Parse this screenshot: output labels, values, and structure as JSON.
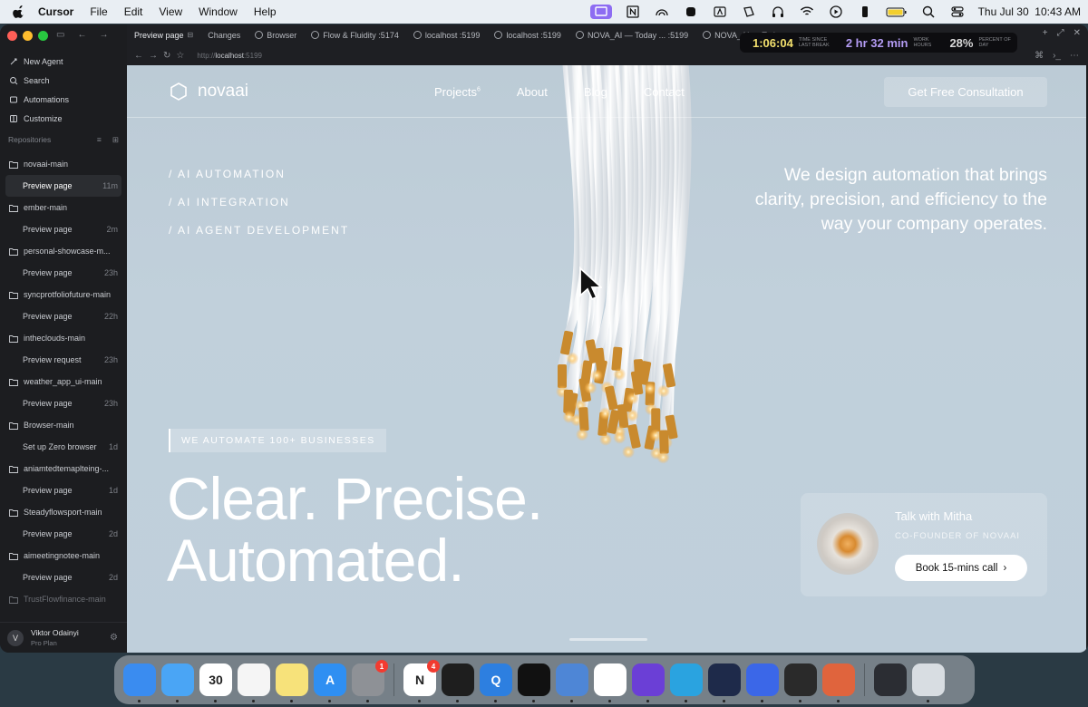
{
  "menubar": {
    "app_name": "Cursor",
    "menus": [
      "File",
      "Edit",
      "View",
      "Window",
      "Help"
    ],
    "clock": "Thu Jul 30  10:43 AM",
    "tray_icons": [
      "display-icon",
      "notion-icon",
      "rainbow-icon",
      "vpn-icon",
      "text-icon",
      "screen-icon",
      "headphones-icon",
      "wifi-icon",
      "play-icon",
      "phone-icon",
      "battery-icon",
      "search-icon",
      "control-center-icon"
    ]
  },
  "sidebar": {
    "nav": [
      {
        "label": "New Agent",
        "icon": "new-agent-icon"
      },
      {
        "label": "Search",
        "icon": "search-icon"
      },
      {
        "label": "Automations",
        "icon": "automations-icon"
      },
      {
        "label": "Customize",
        "icon": "customize-icon"
      }
    ],
    "repos_header": "Repositories",
    "repos": [
      {
        "name": "novaai-main",
        "page": "Preview page",
        "time": "11m",
        "selected": true
      },
      {
        "name": "ember-main",
        "page": "Preview page",
        "time": "2m"
      },
      {
        "name": "personal-showcase-m...",
        "page": "Preview page",
        "time": "23h"
      },
      {
        "name": "syncprotfoliofuture-main",
        "page": "Preview page",
        "time": "22h"
      },
      {
        "name": "intheclouds-main",
        "page": "Preview request",
        "time": "23h"
      },
      {
        "name": "weather_app_ui-main",
        "page": "Preview page",
        "time": "23h"
      },
      {
        "name": "Browser-main",
        "page": "Set up Zero browser",
        "time": "1d"
      },
      {
        "name": "aniamtedtemaplteing-...",
        "page": "Preview page",
        "time": "1d"
      },
      {
        "name": "Steadyflowsport-main",
        "page": "Preview page",
        "time": "2d"
      },
      {
        "name": "aimeetingnotee-main",
        "page": "Preview page",
        "time": "2d"
      },
      {
        "name": "TrustFlowfinance-main",
        "page": "",
        "time": ""
      }
    ],
    "user": {
      "initial": "V",
      "name": "Viktor Odainyi",
      "plan": "Pro Plan"
    }
  },
  "tabs": [
    {
      "label": "Preview page",
      "active": true
    },
    {
      "label": "Changes"
    },
    {
      "label": "Browser",
      "globe": true
    },
    {
      "label": "Flow & Fluidity :5174",
      "globe": true
    },
    {
      "label": "localhost :5199",
      "globe": true
    },
    {
      "label": "localhost :5199",
      "globe": true
    },
    {
      "label": "NOVA_AI — Today ... :5199",
      "globe": true
    },
    {
      "label": "NOVA_AI — Tod",
      "globe": true
    }
  ],
  "timer": {
    "since_break": "1:06:04",
    "since_break_label": "TIME SINCE LAST BREAK",
    "work_hours": "2 hr 32 min",
    "work_hours_label": "WORK HOURS",
    "percent": "28%",
    "percent_label": "PERCENT OF DAY"
  },
  "urlbar": {
    "prefix": "http://",
    "host": "localhost",
    "port": ":5199"
  },
  "site": {
    "logo": "novaai",
    "links": [
      {
        "label": "Projects",
        "sup": "6"
      },
      {
        "label": "About"
      },
      {
        "label": "Blog"
      },
      {
        "label": "Contact"
      }
    ],
    "cta": "Get Free Consultation",
    "services": [
      "/ AI AUTOMATION",
      "/ AI INTEGRATION",
      "/ AI AGENT DEVELOPMENT"
    ],
    "tagline": "We design automation that brings clarity, precision, and efficiency to the way your company operates.",
    "badge": "WE AUTOMATE 100+ BUSINESSES",
    "headline_1": "Clear. Precise.",
    "headline_2": "Automated.",
    "contact": {
      "name": "Talk with Mitha",
      "role": "CO-FOUNDER OF NOVAAI",
      "button": "Book 15-mins call"
    }
  },
  "dock": [
    {
      "name": "finder",
      "color": "#3a8cf0",
      "glyph": ""
    },
    {
      "name": "safari",
      "color": "#4aa5f5",
      "glyph": ""
    },
    {
      "name": "calendar",
      "color": "#ffffff",
      "glyph": "30"
    },
    {
      "name": "reminders",
      "color": "#f5f5f5",
      "glyph": ""
    },
    {
      "name": "notes",
      "color": "#f7e27a",
      "glyph": ""
    },
    {
      "name": "app-store",
      "color": "#2f8ff2",
      "glyph": "A"
    },
    {
      "name": "system-settings",
      "color": "#8e9196",
      "glyph": "",
      "badge": "1"
    },
    {
      "name": "notion",
      "color": "#ffffff",
      "glyph": "N",
      "badge": "4"
    },
    {
      "name": "figma",
      "color": "#1e1e1e",
      "glyph": ""
    },
    {
      "name": "quicktime",
      "color": "#2d7fe0",
      "glyph": "Q"
    },
    {
      "name": "capcut",
      "color": "#111111",
      "glyph": ""
    },
    {
      "name": "finder-alt",
      "color": "#4e86d6",
      "glyph": ""
    },
    {
      "name": "chrome",
      "color": "#ffffff",
      "glyph": ""
    },
    {
      "name": "obsidian",
      "color": "#6b3fd6",
      "glyph": ""
    },
    {
      "name": "telegram",
      "color": "#2aa3e0",
      "glyph": ""
    },
    {
      "name": "arc",
      "color": "#1e2a4a",
      "glyph": ""
    },
    {
      "name": "nordvpn",
      "color": "#3b67e8",
      "glyph": ""
    },
    {
      "name": "cube-app",
      "color": "#2a2a2a",
      "glyph": ""
    },
    {
      "name": "claude",
      "color": "#e0643d",
      "glyph": ""
    },
    {
      "name": "minimized-window",
      "color": "#2b2d33",
      "glyph": ""
    },
    {
      "name": "trash",
      "color": "#d8dde2",
      "glyph": ""
    }
  ]
}
